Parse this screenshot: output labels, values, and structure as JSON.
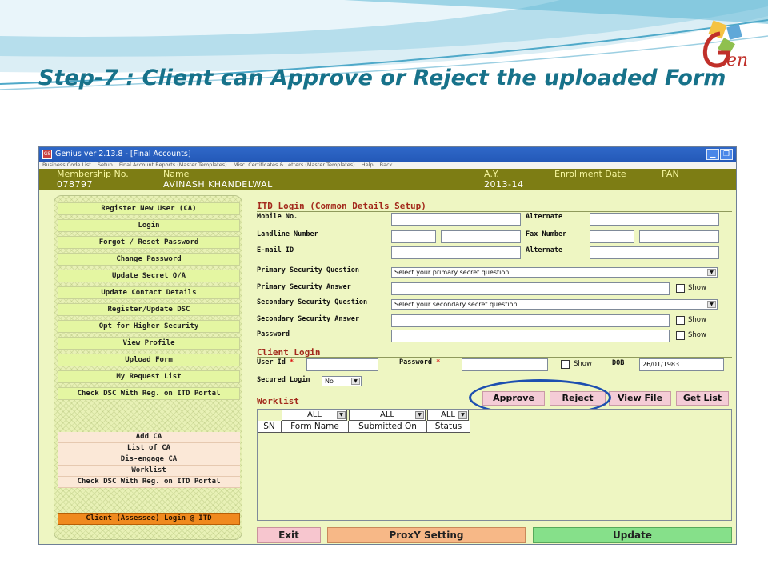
{
  "slide": {
    "title": "Step-7 : Client can Approve or Reject the uploaded Form",
    "logo_text": "Gen"
  },
  "window": {
    "title": "Genius ver 2.13.8 - [Final Accounts]",
    "app_icon": "gs-icon",
    "menu": [
      "Business Code List",
      "Setup",
      "Final Account Reports (Master Templates)",
      "Misc. Certificates & Letters (Master Templates)",
      "Help",
      "Back"
    ]
  },
  "info": {
    "membership_label": "Membership No.",
    "membership_value": "078797",
    "name_label": "Name",
    "name_value": "AVINASH KHANDELWAL",
    "ay_label": "A.Y.",
    "ay_value": "2013-14",
    "enroll_label": "Enrollment Date",
    "pan_label": "PAN"
  },
  "left_menu": [
    "Register New User (CA)",
    "Login",
    "Forgot / Reset Password",
    "Change Password",
    "Update Secret Q/A",
    "Update Contact Details",
    "Register/Update DSC",
    "Opt for Higher Security",
    "View Profile",
    "Upload Form",
    "My Request List",
    "Check DSC With Reg. on ITD Portal"
  ],
  "left_menu2": [
    "Add CA",
    "List of CA",
    "Dis-engage CA",
    "Worklist",
    "Check DSC With Reg. on ITD Portal"
  ],
  "client_login_button": "Client (Assessee) Login @ ITD",
  "itd": {
    "section_title": "ITD Login (Common Details Setup)",
    "mobile_label": "Mobile No.",
    "alternate_label": "Alternate",
    "landline_label": "Landline Number",
    "fax_label": "Fax Number",
    "email_label": "E-mail ID",
    "alternate2_label": "Alternate",
    "pq_label": "Primary Security Question",
    "pq_value": "Select your primary secret question",
    "pa_label": "Primary Security Answer",
    "sq_label": "Secondary Security Question",
    "sq_value": "Select your secondary secret question",
    "sa_label": "Secondary Security Answer",
    "password_label": "Password",
    "show_label": "Show"
  },
  "client_login": {
    "section_title": "Client Login",
    "userid_label": "User Id",
    "password_label": "Password",
    "required_mark": "*",
    "show_label": "Show",
    "dob_label": "DOB",
    "dob_value": "26/01/1983",
    "secured_label": "Secured Login",
    "secured_value": "No"
  },
  "worklist": {
    "title": "Worklist",
    "buttons": [
      "Approve",
      "Reject",
      "View File",
      "Get List"
    ],
    "filters": [
      "ALL",
      "ALL",
      "ALL"
    ],
    "columns": [
      "SN",
      "Form Name",
      "Submitted On",
      "Status"
    ]
  },
  "bottom": {
    "exit": "Exit",
    "proxy": "ProxY Setting",
    "update": "Update"
  },
  "colors": {
    "title": "#17728a",
    "info_bar": "#7d7d14",
    "highlight": "#1d4fb0"
  }
}
